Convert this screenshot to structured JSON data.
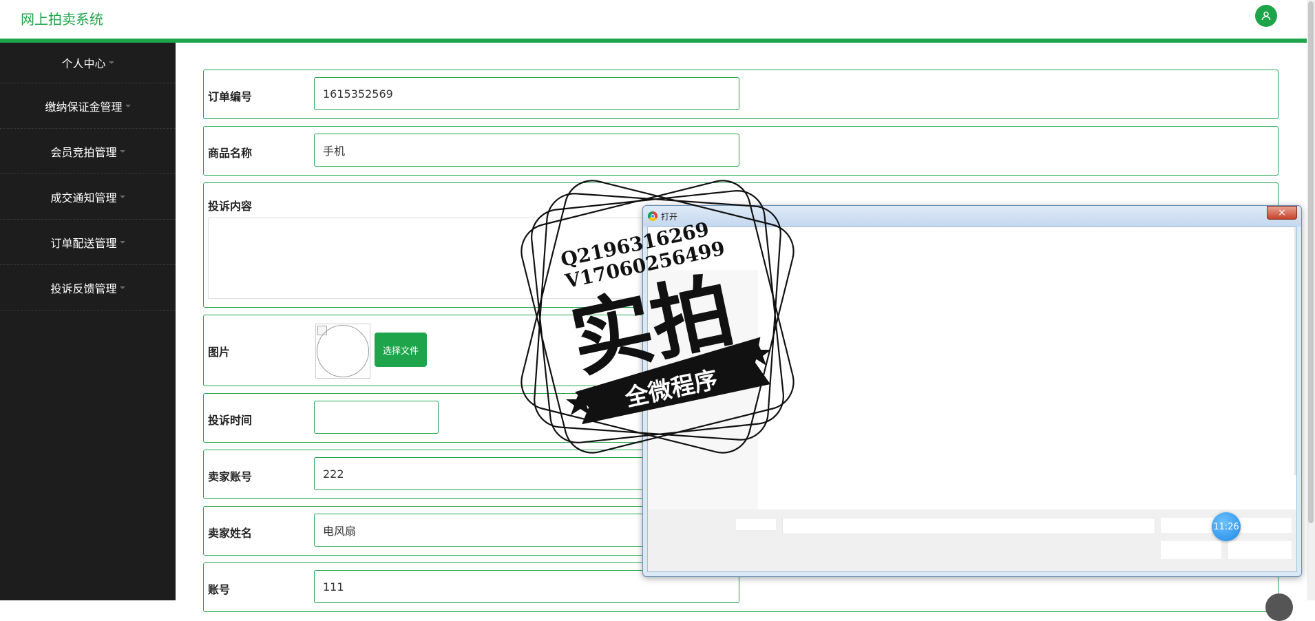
{
  "header": {
    "app_title": "网上拍卖系统",
    "avatar_icon": "user-icon"
  },
  "sidebar": {
    "items": [
      {
        "label": "个人中心"
      },
      {
        "label": "缴纳保证金管理"
      },
      {
        "label": "会员竞拍管理"
      },
      {
        "label": "成交通知管理"
      },
      {
        "label": "订单配送管理"
      },
      {
        "label": "投诉反馈管理"
      }
    ]
  },
  "form": {
    "order_no": {
      "label": "订单编号",
      "value": "1615352569"
    },
    "product_name": {
      "label": "商品名称",
      "value": "手机"
    },
    "complaint_content": {
      "label": "投诉内容",
      "value": ""
    },
    "image": {
      "label": "图片",
      "button": "选择文件"
    },
    "complaint_time": {
      "label": "投诉时间",
      "value": ""
    },
    "seller_account": {
      "label": "卖家账号",
      "value": "222"
    },
    "seller_name": {
      "label": "卖家姓名",
      "value": "电风扇"
    },
    "account": {
      "label": "账号",
      "value": "111"
    }
  },
  "watermark": {
    "line1": "Q2196316269",
    "line2": "V17060256499",
    "main": "实拍",
    "banner": "全微程序"
  },
  "dialog": {
    "title": "打开",
    "close": "×"
  },
  "clock": "11:26",
  "colors": {
    "accent": "#1ea44a",
    "sidebar": "#1d1d1d"
  }
}
